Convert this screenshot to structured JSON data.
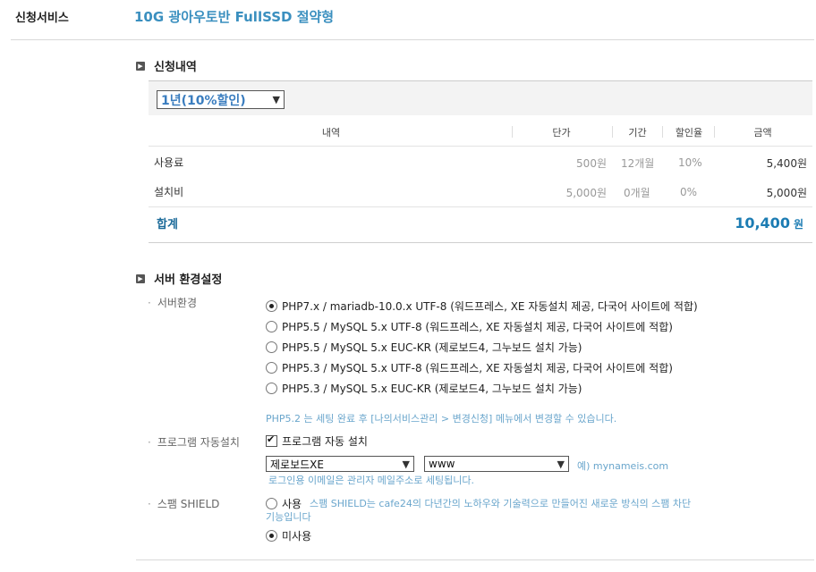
{
  "header": {
    "label": "신청서비스",
    "product": "10G 광아우토반 FullSSD 절약형"
  },
  "order": {
    "title": "신청내역",
    "term_selected": "1년(10%할인)",
    "columns": [
      "내역",
      "단가",
      "기간",
      "할인율",
      "금액"
    ],
    "rows": [
      {
        "item": "사용료",
        "unit_price": "500원",
        "period": "12개월",
        "discount": "10%",
        "amount": "5,400원"
      },
      {
        "item": "설치비",
        "unit_price": "5,000원",
        "period": "0개월",
        "discount": "0%",
        "amount": "5,000원"
      }
    ],
    "total_label": "합계",
    "total_value": "10,400",
    "total_unit": "원"
  },
  "server": {
    "title": "서버 환경설정",
    "env_label": "서버환경",
    "env_options": [
      "PHP7.x / mariadb-10.0.x UTF-8 (워드프레스, XE 자동설치 제공, 다국어 사이트에 적합)",
      "PHP5.5 / MySQL 5.x UTF-8 (워드프레스, XE 자동설치 제공, 다국어 사이트에 적합)",
      "PHP5.5 / MySQL 5.x EUC-KR (제로보드4, 그누보드 설치 가능)",
      "PHP5.3 / MySQL 5.x UTF-8 (워드프레스, XE 자동설치 제공, 다국어 사이트에 적합)",
      "PHP5.3 / MySQL 5.x EUC-KR (제로보드4, 그누보드 설치 가능)"
    ],
    "env_selected_index": 0,
    "env_note": "PHP5.2 는 세팅 완료 후 [나의서비스관리 > 변경신청] 메뉴에서 변경할 수 있습니다.",
    "program_label": "프로그램 자동설치",
    "program_checkbox_label": "프로그램 자동 설치",
    "program_select": "제로보드XE",
    "dir_select": "www",
    "dir_example": "예) mynameis.com",
    "login_note": "로그인용 이메일은 관리자 메일주소로 세팅됩니다.",
    "shield_label": "스팸 SHIELD",
    "shield_use": "사용",
    "shield_desc_line1": "스팸 SHIELD는 cafe24의 다년간의 노하우와 기술력으로 만들어진 새로운 방식의 스팸 차단",
    "shield_desc_line2": "기능입니다",
    "shield_nouse": "미사용"
  }
}
